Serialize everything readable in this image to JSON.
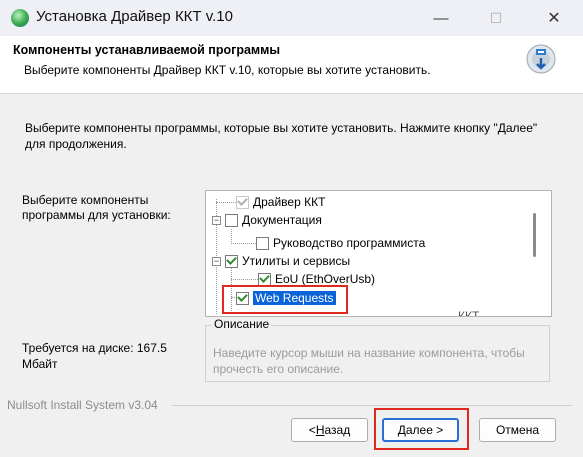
{
  "window": {
    "title": "Установка Драйвер ККТ v.10",
    "minimize": "—",
    "maximize": "☐",
    "close": "✕"
  },
  "header": {
    "title": "Компоненты устанавливаемой программы",
    "subtitle": "Выберите компоненты Драйвер ККТ v.10, которые вы хотите установить."
  },
  "body": {
    "intro": "Выберите компоненты программы, которые вы хотите установить. Нажмите кнопку \"Далее\" для продолжения.",
    "choose_label": "Выберите компоненты программы для установки:",
    "space_required": "Требуется на диске: 167.5 Мбайт"
  },
  "tree": {
    "items": [
      {
        "label": "Драйвер ККТ",
        "checked": true
      },
      {
        "label": "Документация",
        "checked": false
      },
      {
        "label": "Руководство программиста",
        "checked": false
      },
      {
        "label": "Утилиты и сервисы",
        "checked": true
      },
      {
        "label": "EoU (EthOverUsb)",
        "checked": true
      },
      {
        "label": "Web Requests",
        "checked": true,
        "selected": true
      },
      {
        "label": "ККТ"
      }
    ]
  },
  "description": {
    "legend": "Описание",
    "text": "Наведите курсор мыши на название компонента, чтобы прочесть его описание."
  },
  "footer": {
    "nsis": "Nullsoft Install System v3.04",
    "back_pre": "< ",
    "back_u": "Н",
    "back_post": "азад",
    "next_u": "Д",
    "next_post": "алее >",
    "cancel": "Отмена"
  },
  "colors": {
    "highlight": "#e0281e",
    "selection": "#0a64d8"
  }
}
